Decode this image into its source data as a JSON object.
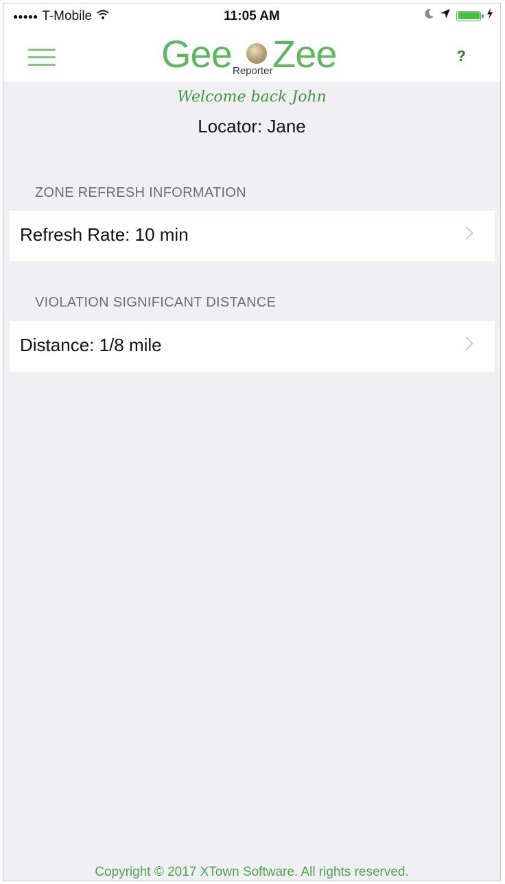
{
  "status_bar": {
    "signal": "●●●●●",
    "carrier": "T-Mobile",
    "time": "11:05 AM",
    "wifi_icon": "wifi-icon",
    "moon_icon": "moon-icon",
    "location_icon": "location-arrow-icon",
    "charging_icon": "bolt-icon",
    "battery_level": 1.0,
    "battery_color": "#3ec43a"
  },
  "nav": {
    "logo_left": "Gee",
    "logo_right": "Zee",
    "logo_sub": "Reporter",
    "help_label": "?",
    "menu_icon": "hamburger-icon",
    "brand_color": "#5cb85c"
  },
  "welcome": {
    "greeting": "Welcome back John",
    "locator": "Locator: Jane"
  },
  "sections": [
    {
      "header": "ZONE REFRESH INFORMATION",
      "item_label": "Refresh Rate: 10 min"
    },
    {
      "header": "VIOLATION SIGNIFICANT DISTANCE",
      "item_label": "Distance: 1/8 mile"
    }
  ],
  "footer": {
    "copyright": "Copyright ©  2017 XTown Software. All rights reserved."
  }
}
